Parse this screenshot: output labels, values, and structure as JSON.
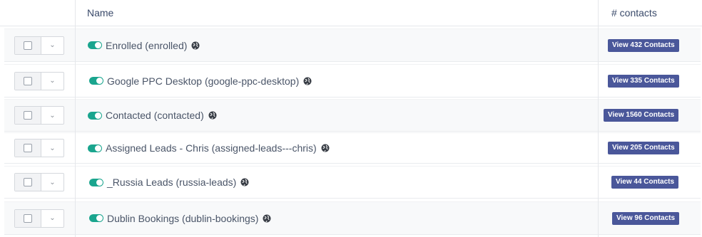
{
  "header": {
    "name_label": "Name",
    "contacts_label": "# contacts"
  },
  "rows": [
    {
      "name": "Enrolled (enrolled)",
      "button": "View 432 Contacts",
      "enabled": true
    },
    {
      "name": "Google PPC Desktop (google-ppc-desktop)",
      "button": "View 335 Contacts",
      "enabled": true
    },
    {
      "name": "Contacted (contacted)",
      "button": "View 1560 Contacts",
      "enabled": true
    },
    {
      "name": "Assigned Leads - Chris (assigned-leads---chris)",
      "button": "View 205 Contacts",
      "enabled": true
    },
    {
      "name": "_Russia Leads (russia-leads)",
      "button": "View 44 Contacts",
      "enabled": true
    },
    {
      "name": "Dublin Bookings (dublin-bookings)",
      "button": "View 96 Contacts",
      "enabled": true
    }
  ],
  "icons": {
    "toggle": "toggle-on-icon",
    "globe": "globe-icon",
    "dropdown": "chevron-down-icon"
  },
  "colors": {
    "toggle_on": "#1aa58e",
    "button_bg": "#4a579a",
    "text": "#4a5568"
  }
}
